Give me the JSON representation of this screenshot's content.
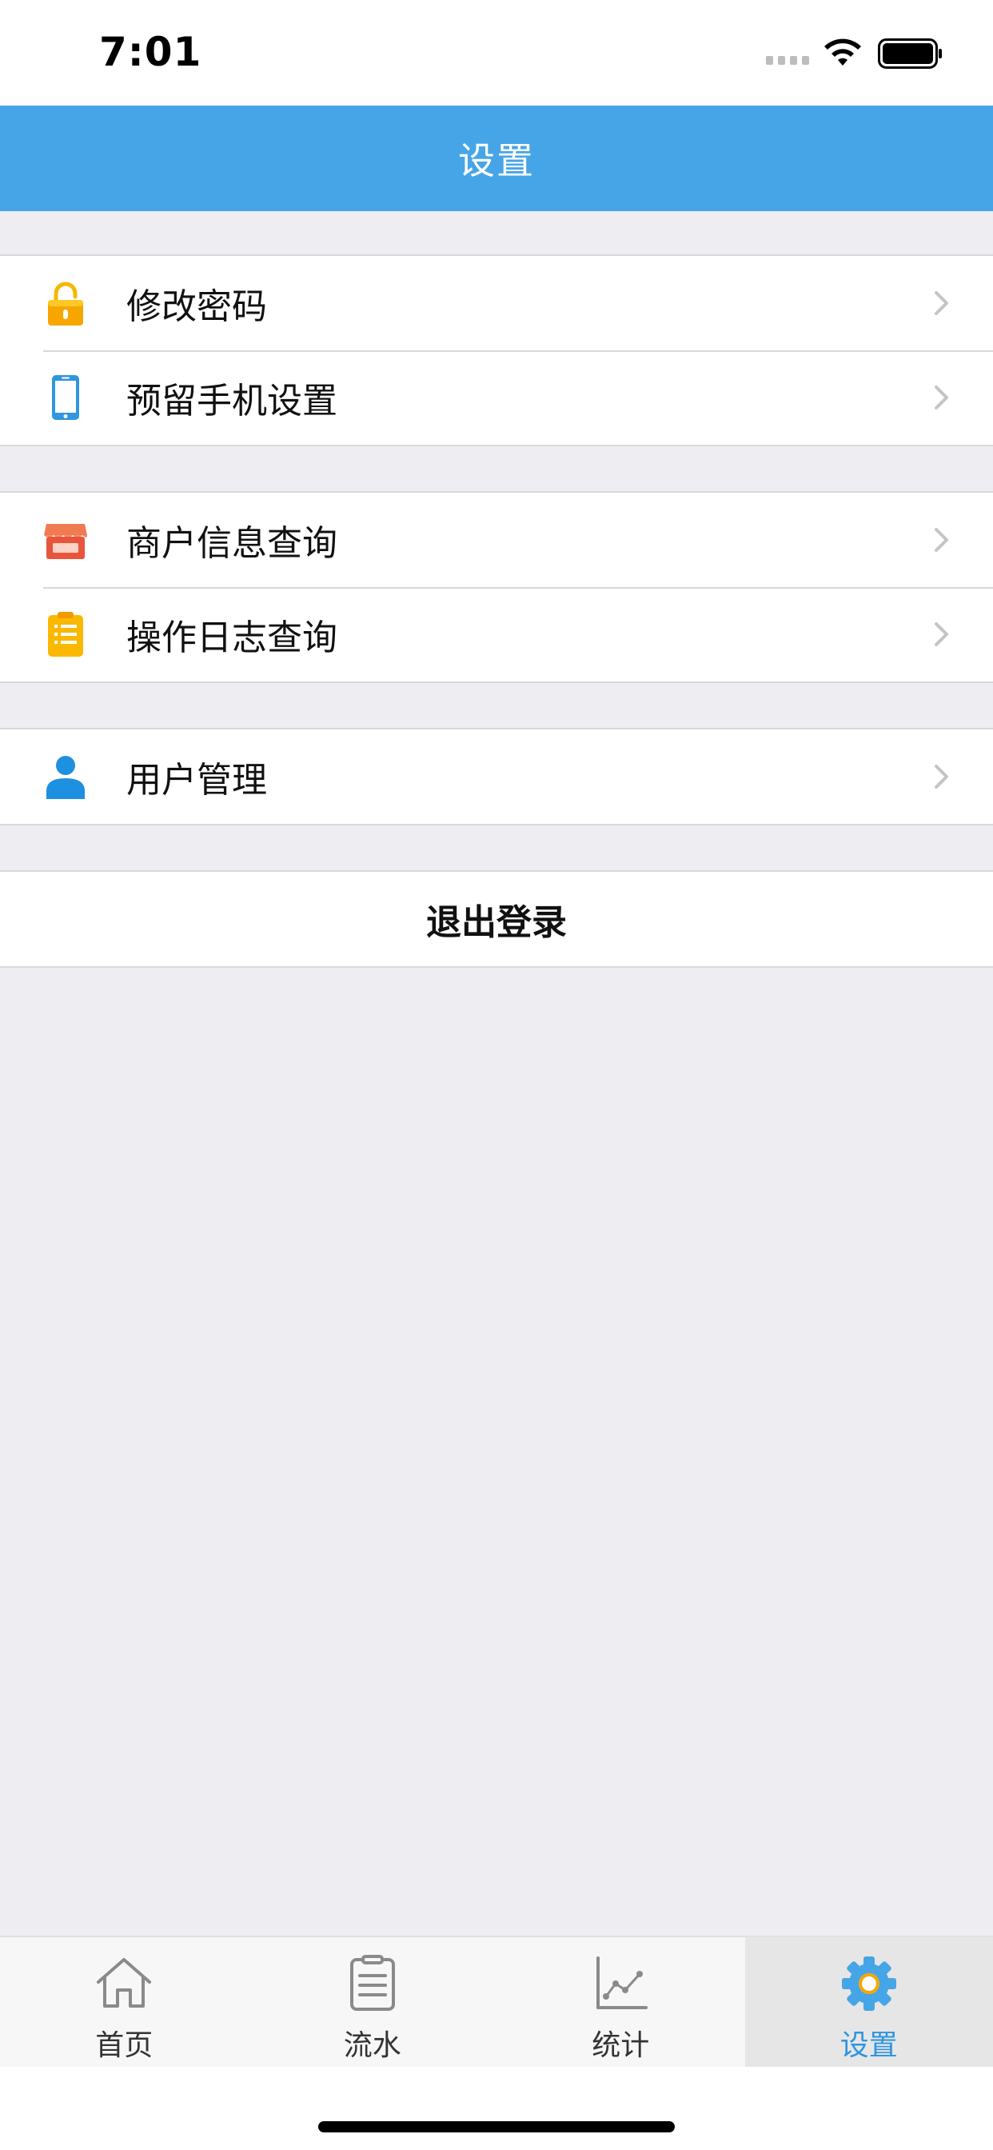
{
  "status_bar": {
    "time": "7:01"
  },
  "nav": {
    "title": "设置"
  },
  "groups": [
    {
      "items": [
        {
          "label": "修改密码",
          "icon": "lock-icon",
          "color": "#F5B800"
        },
        {
          "label": "预留手机设置",
          "icon": "phone-icon",
          "color": "#2F96DF"
        }
      ]
    },
    {
      "items": [
        {
          "label": "商户信息查询",
          "icon": "store-icon",
          "color": "#F06A4A"
        },
        {
          "label": "操作日志查询",
          "icon": "clipboard-icon",
          "color": "#F7B500"
        }
      ]
    },
    {
      "items": [
        {
          "label": "用户管理",
          "icon": "user-icon",
          "color": "#1E90E0"
        }
      ]
    }
  ],
  "logout": {
    "label": "退出登录"
  },
  "tabs": [
    {
      "label": "首页",
      "icon": "home-icon"
    },
    {
      "label": "流水",
      "icon": "list-icon"
    },
    {
      "label": "统计",
      "icon": "chart-icon"
    },
    {
      "label": "设置",
      "icon": "gear-icon",
      "active": true
    }
  ],
  "colors": {
    "accent": "#46A5E6",
    "active_tab_text": "#2F96DF",
    "background": "#EEEEF2"
  }
}
